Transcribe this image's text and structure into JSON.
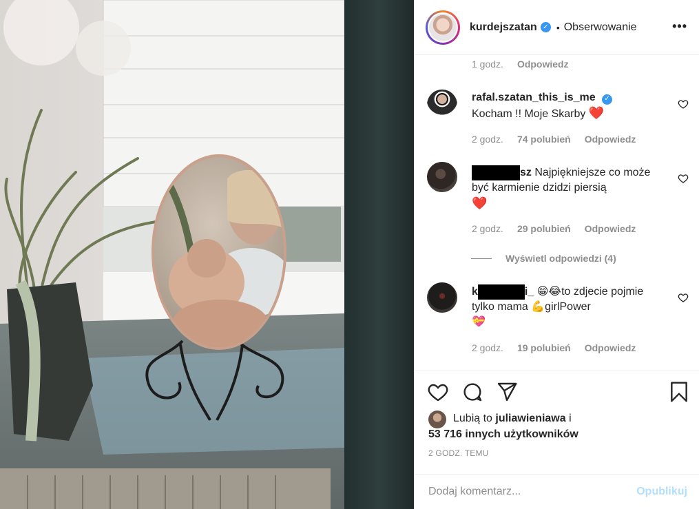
{
  "post": {
    "photo_alt": "photo",
    "author": "kurdejszatan",
    "separator": "•",
    "follow_label": "Obserwowanie",
    "more_label": "•••"
  },
  "comments": {
    "first_meta": {
      "time": "1 godz.",
      "reply": "Odpowiedz"
    },
    "items": [
      {
        "user": "rafal.szatan_this_is_me",
        "text": "Kocham !! Moje Skarby",
        "emoji": "❤️",
        "time": "2 godz.",
        "likes": "74 polubień",
        "reply": "Odpowiedz"
      },
      {
        "user_suffix": "sz",
        "text": "Najpiękniejsze co może być karmienie dzidzi piersią",
        "emoji": "❤️",
        "time": "2 godz.",
        "likes": "29 polubień",
        "reply": "Odpowiedz"
      },
      {
        "user_prefix": "k",
        "user_suffix": "i_",
        "text_emoji": "😁😂",
        "text": "to zdjecie pojmie tylko mama",
        "emoji_mid": "💪",
        "text2": "girlPower",
        "emoji_end": "💝",
        "time": "2 godz.",
        "likes": "19 polubień",
        "reply": "Odpowiedz"
      }
    ],
    "view_replies": "Wyświetl odpowiedzi (4)"
  },
  "likes": {
    "prefix": "Lubią to",
    "liker": "juliawieniawa",
    "conj": "i",
    "others": "53 716 innych użytkowników"
  },
  "time_ago": "2 GODZ. TEMU",
  "add_comment": {
    "placeholder": "Dodaj komentarz...",
    "publish": "Opublikuj"
  },
  "colors": {
    "verified": "#3897f0",
    "secondary_text": "#8e8e8e",
    "publish_disabled": "#b2dffc",
    "heart_red": "#e0245e"
  }
}
